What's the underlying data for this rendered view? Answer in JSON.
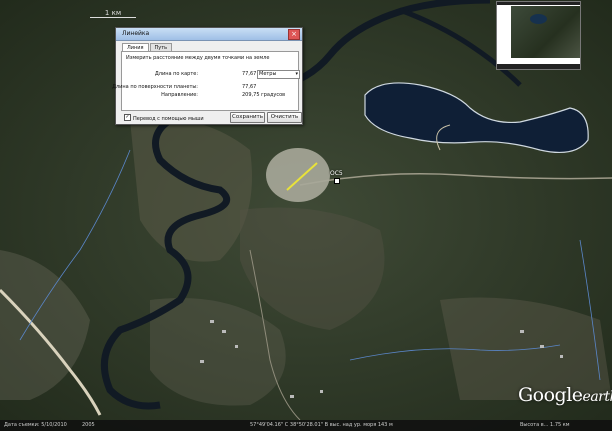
{
  "scale_label": "1 км",
  "dialog": {
    "title": "Линейка",
    "tabs": [
      "Линия",
      "Путь"
    ],
    "description": "Измерить расстояние между двумя точками на земле",
    "map_length_label": "Длина по карте:",
    "map_length_value": "77,67",
    "unit_selected": "Метры",
    "ground_length_label": "Длина по поверхности планеты:",
    "ground_length_value": "77,67",
    "heading_label": "Направление:",
    "heading_value": "209,75 градусов",
    "checkbox_label": "Перевод с помощью мыши",
    "checkbox_checked": true,
    "save_label": "Сохранить",
    "clear_label": "Очистить"
  },
  "map_label": "ОС5",
  "branding": {
    "word": "Google",
    "suffix": "earth"
  },
  "status_bar": {
    "date": "Дата съемки: 5/10/2010",
    "year": "2005",
    "coords": "57°49'04.16\" С 38°50'28.01\" В  выс. над ур. моря 143 м",
    "eye_alt": "Высота в... 1.75 км"
  },
  "colors": {
    "ruler_line": "#e8e23a",
    "water": "#0f1f36",
    "titlebar": "#b6d1f0"
  }
}
